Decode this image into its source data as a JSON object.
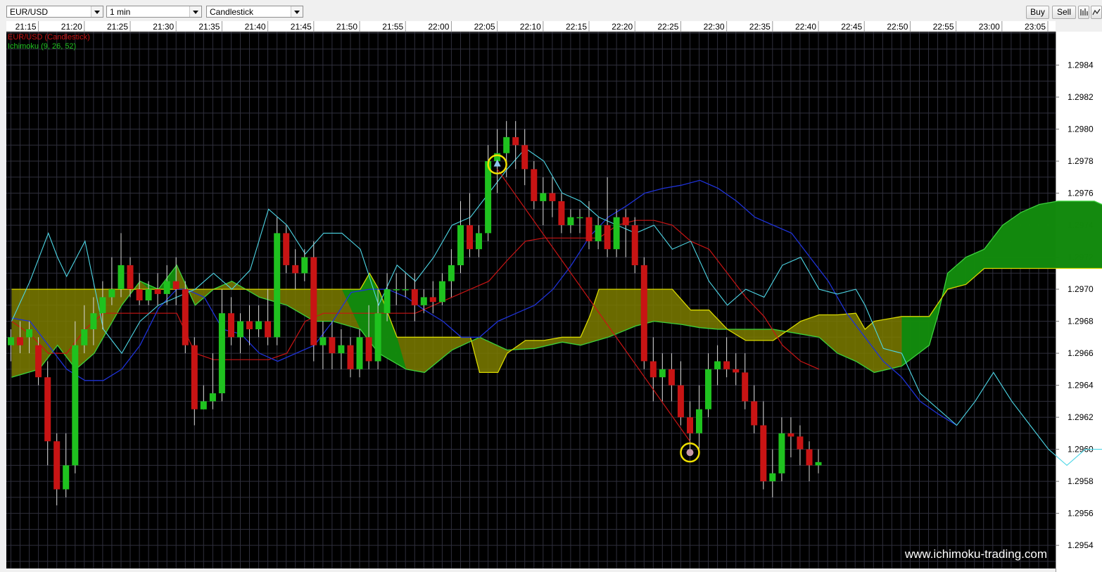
{
  "toolbar": {
    "symbol": "EUR/USD",
    "timeframe": "1 min",
    "chart_type": "Candlestick",
    "buy_label": "Buy",
    "sell_label": "Sell",
    "chart_icon": "bar-chart-icon",
    "settings_icon": "indicator-settings-icon"
  },
  "legend": {
    "series1": "EUR/USD (Candlestick)",
    "series2": "Ichimoku (9, 26, 52)"
  },
  "watermark": "www.ichimoku-trading.com",
  "colors": {
    "background": "#000000",
    "grid": "#2f2f3c",
    "bull": "#1fc21f",
    "bear": "#c81414",
    "tenkan": "#1e32d6",
    "kijun": "#c81414",
    "chikou": "#4dd6e6",
    "kumo_bull": "#0e8a0e",
    "kumo_bear": "#7d7d00",
    "senkou_a": "#3cd03c",
    "senkou_b": "#d8d800",
    "signal_circle": "#f0e000",
    "trade_line": "#c81414"
  },
  "chart_data": {
    "type": "candlestick",
    "symbol": "EUR/USD",
    "interval": "1 min",
    "indicator": "Ichimoku (9, 26, 52)",
    "time_axis_labels": [
      "21:15",
      "21:20",
      "21:25",
      "21:30",
      "21:35",
      "21:40",
      "21:45",
      "21:50",
      "21:55",
      "22:00",
      "22:05",
      "22:10",
      "22:15",
      "22:20",
      "22:25",
      "22:30",
      "22:35",
      "22:40",
      "22:45",
      "22:50",
      "22:55",
      "23:00",
      "23:05"
    ],
    "time_axis_start": "21:12",
    "price_axis_labels": [
      "1.2984",
      "1.2982",
      "1.2980",
      "1.2978",
      "1.2976",
      "1.2974",
      "1.2972",
      "1.2970",
      "1.2968",
      "1.2966",
      "1.2964",
      "1.2962",
      "1.2960",
      "1.2958",
      "1.2956",
      "1.2954"
    ],
    "price_range": [
      1.29526,
      1.2986
    ],
    "candles": [
      {
        "t": "21:12",
        "o": 1.29665,
        "h": 1.29675,
        "l": 1.29655,
        "c": 1.2967
      },
      {
        "t": "21:13",
        "o": 1.2967,
        "h": 1.2968,
        "l": 1.2966,
        "c": 1.29665
      },
      {
        "t": "21:14",
        "o": 1.2967,
        "h": 1.2968,
        "l": 1.2966,
        "c": 1.29675
      },
      {
        "t": "21:15",
        "o": 1.29665,
        "h": 1.2967,
        "l": 1.2964,
        "c": 1.29645
      },
      {
        "t": "21:16",
        "o": 1.29645,
        "h": 1.29655,
        "l": 1.2959,
        "c": 1.29605
      },
      {
        "t": "21:17",
        "o": 1.29605,
        "h": 1.2961,
        "l": 1.29565,
        "c": 1.29575
      },
      {
        "t": "21:18",
        "o": 1.29575,
        "h": 1.2961,
        "l": 1.2957,
        "c": 1.2959
      },
      {
        "t": "21:19",
        "o": 1.2959,
        "h": 1.2968,
        "l": 1.29585,
        "c": 1.29665
      },
      {
        "t": "21:20",
        "o": 1.29665,
        "h": 1.2969,
        "l": 1.2966,
        "c": 1.29675
      },
      {
        "t": "21:21",
        "o": 1.29675,
        "h": 1.29695,
        "l": 1.29665,
        "c": 1.29685
      },
      {
        "t": "21:22",
        "o": 1.29685,
        "h": 1.29705,
        "l": 1.29675,
        "c": 1.29695
      },
      {
        "t": "21:23",
        "o": 1.29695,
        "h": 1.2972,
        "l": 1.2969,
        "c": 1.297
      },
      {
        "t": "21:24",
        "o": 1.297,
        "h": 1.29735,
        "l": 1.29695,
        "c": 1.29715
      },
      {
        "t": "21:25",
        "o": 1.29715,
        "h": 1.2972,
        "l": 1.29695,
        "c": 1.297
      },
      {
        "t": "21:26",
        "o": 1.297,
        "h": 1.2971,
        "l": 1.2969,
        "c": 1.29693
      },
      {
        "t": "21:27",
        "o": 1.29693,
        "h": 1.29705,
        "l": 1.2969,
        "c": 1.297
      },
      {
        "t": "21:28",
        "o": 1.297,
        "h": 1.2971,
        "l": 1.2969,
        "c": 1.29697
      },
      {
        "t": "21:29",
        "o": 1.29697,
        "h": 1.29715,
        "l": 1.2969,
        "c": 1.29705
      },
      {
        "t": "21:30",
        "o": 1.29705,
        "h": 1.2972,
        "l": 1.2969,
        "c": 1.297
      },
      {
        "t": "21:31",
        "o": 1.297,
        "h": 1.29705,
        "l": 1.2966,
        "c": 1.29665
      },
      {
        "t": "21:32",
        "o": 1.29665,
        "h": 1.2967,
        "l": 1.29615,
        "c": 1.29625
      },
      {
        "t": "21:33",
        "o": 1.29625,
        "h": 1.2964,
        "l": 1.29625,
        "c": 1.2963
      },
      {
        "t": "21:34",
        "o": 1.2963,
        "h": 1.2966,
        "l": 1.29625,
        "c": 1.29635
      },
      {
        "t": "21:35",
        "o": 1.29635,
        "h": 1.297,
        "l": 1.2963,
        "c": 1.29685
      },
      {
        "t": "21:36",
        "o": 1.29685,
        "h": 1.29695,
        "l": 1.29665,
        "c": 1.2967
      },
      {
        "t": "21:37",
        "o": 1.2967,
        "h": 1.29685,
        "l": 1.2966,
        "c": 1.2968
      },
      {
        "t": "21:38",
        "o": 1.2968,
        "h": 1.2969,
        "l": 1.29665,
        "c": 1.29675
      },
      {
        "t": "21:39",
        "o": 1.29675,
        "h": 1.2969,
        "l": 1.2967,
        "c": 1.2968
      },
      {
        "t": "21:40",
        "o": 1.2968,
        "h": 1.297,
        "l": 1.29665,
        "c": 1.2967
      },
      {
        "t": "21:41",
        "o": 1.2967,
        "h": 1.29745,
        "l": 1.29665,
        "c": 1.29735
      },
      {
        "t": "21:42",
        "o": 1.29735,
        "h": 1.2974,
        "l": 1.2971,
        "c": 1.29715
      },
      {
        "t": "21:43",
        "o": 1.29715,
        "h": 1.29725,
        "l": 1.297,
        "c": 1.2971
      },
      {
        "t": "21:44",
        "o": 1.2971,
        "h": 1.29725,
        "l": 1.29705,
        "c": 1.2972
      },
      {
        "t": "21:45",
        "o": 1.2972,
        "h": 1.2973,
        "l": 1.29655,
        "c": 1.29665
      },
      {
        "t": "21:46",
        "o": 1.29665,
        "h": 1.2968,
        "l": 1.2965,
        "c": 1.2967
      },
      {
        "t": "21:47",
        "o": 1.2967,
        "h": 1.2968,
        "l": 1.2965,
        "c": 1.2966
      },
      {
        "t": "21:48",
        "o": 1.2966,
        "h": 1.29675,
        "l": 1.2965,
        "c": 1.29665
      },
      {
        "t": "21:49",
        "o": 1.29665,
        "h": 1.2967,
        "l": 1.29645,
        "c": 1.2965
      },
      {
        "t": "21:50",
        "o": 1.2965,
        "h": 1.29675,
        "l": 1.29645,
        "c": 1.2967
      },
      {
        "t": "21:51",
        "o": 1.2967,
        "h": 1.2969,
        "l": 1.2965,
        "c": 1.29655
      },
      {
        "t": "21:52",
        "o": 1.29655,
        "h": 1.297,
        "l": 1.2965,
        "c": 1.29685
      },
      {
        "t": "21:53",
        "o": 1.29685,
        "h": 1.2971,
        "l": 1.2968,
        "c": 1.297
      },
      {
        "t": "21:54",
        "o": 1.297,
        "h": 1.2971,
        "l": 1.2969,
        "c": 1.297
      },
      {
        "t": "21:55",
        "o": 1.297,
        "h": 1.2971,
        "l": 1.29695,
        "c": 1.297
      },
      {
        "t": "21:56",
        "o": 1.297,
        "h": 1.2971,
        "l": 1.2968,
        "c": 1.2969
      },
      {
        "t": "21:57",
        "o": 1.2969,
        "h": 1.297,
        "l": 1.29685,
        "c": 1.29695
      },
      {
        "t": "21:58",
        "o": 1.29695,
        "h": 1.29705,
        "l": 1.29685,
        "c": 1.29692
      },
      {
        "t": "21:59",
        "o": 1.29692,
        "h": 1.2971,
        "l": 1.2969,
        "c": 1.29705
      },
      {
        "t": "22:00",
        "o": 1.29705,
        "h": 1.29725,
        "l": 1.29695,
        "c": 1.29715
      },
      {
        "t": "22:01",
        "o": 1.29715,
        "h": 1.29755,
        "l": 1.2971,
        "c": 1.2974
      },
      {
        "t": "22:02",
        "o": 1.2974,
        "h": 1.2976,
        "l": 1.2972,
        "c": 1.29725
      },
      {
        "t": "22:03",
        "o": 1.29725,
        "h": 1.2974,
        "l": 1.2972,
        "c": 1.29735
      },
      {
        "t": "22:04",
        "o": 1.29735,
        "h": 1.2979,
        "l": 1.2973,
        "c": 1.2978
      },
      {
        "t": "22:05",
        "o": 1.2978,
        "h": 1.298,
        "l": 1.2976,
        "c": 1.29785
      },
      {
        "t": "22:06",
        "o": 1.29785,
        "h": 1.29805,
        "l": 1.2977,
        "c": 1.29795
      },
      {
        "t": "22:07",
        "o": 1.29795,
        "h": 1.29805,
        "l": 1.29775,
        "c": 1.2979
      },
      {
        "t": "22:08",
        "o": 1.2979,
        "h": 1.298,
        "l": 1.29765,
        "c": 1.29775
      },
      {
        "t": "22:09",
        "o": 1.29775,
        "h": 1.2978,
        "l": 1.2975,
        "c": 1.29755
      },
      {
        "t": "22:10",
        "o": 1.29755,
        "h": 1.2977,
        "l": 1.2974,
        "c": 1.2976
      },
      {
        "t": "22:11",
        "o": 1.2976,
        "h": 1.2977,
        "l": 1.29745,
        "c": 1.29755
      },
      {
        "t": "22:12",
        "o": 1.29755,
        "h": 1.2976,
        "l": 1.29735,
        "c": 1.2974
      },
      {
        "t": "22:13",
        "o": 1.2974,
        "h": 1.2975,
        "l": 1.29735,
        "c": 1.29745
      },
      {
        "t": "22:14",
        "o": 1.29745,
        "h": 1.2975,
        "l": 1.29735,
        "c": 1.29745
      },
      {
        "t": "22:15",
        "o": 1.29745,
        "h": 1.29755,
        "l": 1.29725,
        "c": 1.2973
      },
      {
        "t": "22:16",
        "o": 1.2973,
        "h": 1.29745,
        "l": 1.29725,
        "c": 1.2974
      },
      {
        "t": "22:17",
        "o": 1.2974,
        "h": 1.2977,
        "l": 1.2972,
        "c": 1.29725
      },
      {
        "t": "22:18",
        "o": 1.29725,
        "h": 1.2975,
        "l": 1.2972,
        "c": 1.29745
      },
      {
        "t": "22:19",
        "o": 1.29745,
        "h": 1.2975,
        "l": 1.2972,
        "c": 1.2974
      },
      {
        "t": "22:20",
        "o": 1.2974,
        "h": 1.29745,
        "l": 1.2971,
        "c": 1.29715
      },
      {
        "t": "22:21",
        "o": 1.29715,
        "h": 1.2972,
        "l": 1.2965,
        "c": 1.29655
      },
      {
        "t": "22:22",
        "o": 1.29655,
        "h": 1.2967,
        "l": 1.2963,
        "c": 1.29645
      },
      {
        "t": "22:23",
        "o": 1.29645,
        "h": 1.2966,
        "l": 1.2963,
        "c": 1.2965
      },
      {
        "t": "22:24",
        "o": 1.2965,
        "h": 1.2966,
        "l": 1.2963,
        "c": 1.2964
      },
      {
        "t": "22:25",
        "o": 1.2964,
        "h": 1.29655,
        "l": 1.29615,
        "c": 1.2962
      },
      {
        "t": "22:26",
        "o": 1.2962,
        "h": 1.2963,
        "l": 1.296,
        "c": 1.2961
      },
      {
        "t": "22:27",
        "o": 1.2961,
        "h": 1.2964,
        "l": 1.296,
        "c": 1.29625
      },
      {
        "t": "22:28",
        "o": 1.29625,
        "h": 1.2966,
        "l": 1.2962,
        "c": 1.2965
      },
      {
        "t": "22:29",
        "o": 1.2965,
        "h": 1.29665,
        "l": 1.2964,
        "c": 1.29655
      },
      {
        "t": "22:30",
        "o": 1.29655,
        "h": 1.2967,
        "l": 1.29645,
        "c": 1.2965
      },
      {
        "t": "22:31",
        "o": 1.2965,
        "h": 1.2966,
        "l": 1.2964,
        "c": 1.29648
      },
      {
        "t": "22:32",
        "o": 1.29648,
        "h": 1.2966,
        "l": 1.29625,
        "c": 1.2963
      },
      {
        "t": "22:33",
        "o": 1.2963,
        "h": 1.2964,
        "l": 1.2961,
        "c": 1.29615
      },
      {
        "t": "22:34",
        "o": 1.29615,
        "h": 1.2963,
        "l": 1.29575,
        "c": 1.2958
      },
      {
        "t": "22:35",
        "o": 1.2958,
        "h": 1.296,
        "l": 1.2957,
        "c": 1.29585
      },
      {
        "t": "22:36",
        "o": 1.29585,
        "h": 1.2962,
        "l": 1.2958,
        "c": 1.2961
      },
      {
        "t": "22:37",
        "o": 1.2961,
        "h": 1.2962,
        "l": 1.29595,
        "c": 1.29608
      },
      {
        "t": "22:38",
        "o": 1.29608,
        "h": 1.29615,
        "l": 1.2959,
        "c": 1.296
      },
      {
        "t": "22:39",
        "o": 1.296,
        "h": 1.29605,
        "l": 1.2958,
        "c": 1.2959
      },
      {
        "t": "22:40",
        "o": 1.2959,
        "h": 1.296,
        "l": 1.29585,
        "c": 1.29592
      }
    ],
    "signals": [
      {
        "type": "buy-arrow",
        "t": "22:05",
        "price": 1.29778
      },
      {
        "type": "exit-dot",
        "t": "22:26",
        "price": 1.29598
      }
    ],
    "trade_line": {
      "from_t": "22:05",
      "from_price": 1.29775,
      "to_t": "22:26",
      "to_price": 1.29605
    }
  }
}
